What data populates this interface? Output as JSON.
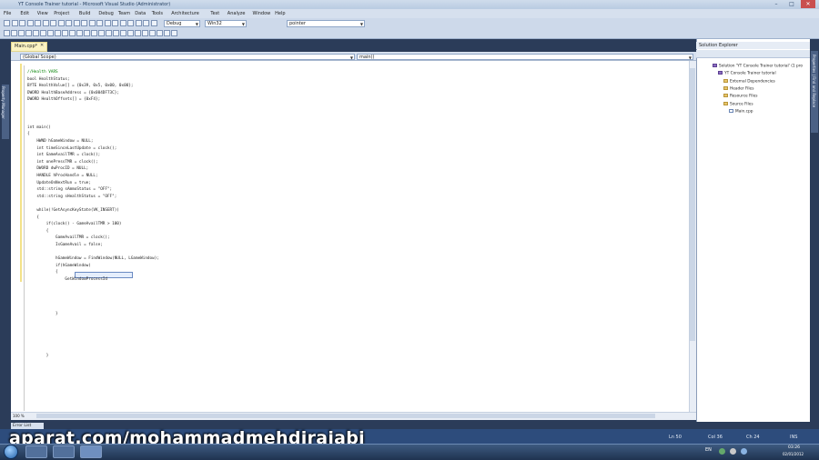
{
  "window": {
    "title": "YT Console Trainer tutorial - Microsoft Visual Studio (Administrator)",
    "minimize": "–",
    "maximize": "□",
    "close": "✕"
  },
  "menu": [
    "File",
    "Edit",
    "View",
    "Project",
    "Build",
    "Debug",
    "Team",
    "Data",
    "Tools",
    "Architecture",
    "Test",
    "Analyze",
    "Window",
    "Help"
  ],
  "toolbar": {
    "config": "Debug",
    "platform": "Win32",
    "find": "pointer"
  },
  "left_strip_label": "Property Manager",
  "document_tab": {
    "label": "Main.cpp*",
    "close": "✕"
  },
  "navbar": {
    "scope": "(Global Scope)",
    "member": "main()"
  },
  "code": [
    {
      "t": "cm",
      "s": "//Health VARS"
    },
    {
      "t": "n",
      "s": "bool HealthStatus;"
    },
    {
      "t": "n",
      "s": "BYTE HealthValue[] = {0x39, 0x5, 0x00, 0x00};"
    },
    {
      "t": "n",
      "s": "DWORD HealthBaseAddress = {0x004DF73C};"
    },
    {
      "t": "n",
      "s": "DWORD HealthOffsets[] = {0xF4};"
    },
    {
      "t": "b",
      "s": ""
    },
    {
      "t": "b",
      "s": ""
    },
    {
      "t": "b",
      "s": ""
    },
    {
      "t": "kw",
      "s": "int main()"
    },
    {
      "t": "n",
      "s": "{"
    },
    {
      "t": "n",
      "s": "    HWND hGameWindow = NULL;"
    },
    {
      "t": "n",
      "s": "    int timeSinceLastUpdate = clock();"
    },
    {
      "t": "n",
      "s": "    int GameAvailTMR = clock();"
    },
    {
      "t": "n",
      "s": "    int onePressTMR = clock();"
    },
    {
      "t": "n",
      "s": "    DWORD dwProcID = NULL;"
    },
    {
      "t": "n",
      "s": "    HANDLE hProcHandle = NULL;"
    },
    {
      "t": "n",
      "s": "    UpdateOnNextRun = true;"
    },
    {
      "t": "n",
      "s": "    std::string sAmmoStatus = \"OFF\";"
    },
    {
      "t": "n",
      "s": "    std::string sHealthStatus = \"OFF\";"
    },
    {
      "t": "b",
      "s": ""
    },
    {
      "t": "n",
      "s": "    while(!GetAsyncKeyState(VK_INSERT))"
    },
    {
      "t": "n",
      "s": "    {"
    },
    {
      "t": "n",
      "s": "        if(clock() - GameAvailTMR > 100)"
    },
    {
      "t": "n",
      "s": "        {"
    },
    {
      "t": "n",
      "s": "            GameAvailTMR = clock();"
    },
    {
      "t": "n",
      "s": "            IsGameAvail = false;"
    },
    {
      "t": "b",
      "s": ""
    },
    {
      "t": "n",
      "s": "            hGameWindow = FindWindow(NULL, LGameWindow);"
    },
    {
      "t": "n",
      "s": "            if(hGameWindow)"
    },
    {
      "t": "n",
      "s": "            {"
    },
    {
      "t": "n",
      "s": "                GetWindowProcessId"
    },
    {
      "t": "b",
      "s": ""
    },
    {
      "t": "b",
      "s": ""
    },
    {
      "t": "b",
      "s": ""
    },
    {
      "t": "b",
      "s": ""
    },
    {
      "t": "n",
      "s": "            }"
    },
    {
      "t": "b",
      "s": ""
    },
    {
      "t": "b",
      "s": ""
    },
    {
      "t": "b",
      "s": ""
    },
    {
      "t": "b",
      "s": ""
    },
    {
      "t": "b",
      "s": ""
    },
    {
      "t": "n",
      "s": "        }"
    }
  ],
  "editor": {
    "zoom": "100 %"
  },
  "solution_explorer": {
    "title": "Solution Explorer",
    "items": [
      {
        "label": "Solution 'YT Console Trainer tutorial' (1 pro",
        "indent": 0,
        "icon": "sln"
      },
      {
        "label": "YT Console Trainer tutorial",
        "indent": 1,
        "icon": "sln"
      },
      {
        "label": "External Dependencies",
        "indent": 2,
        "icon": "folder"
      },
      {
        "label": "Header Files",
        "indent": 2,
        "icon": "folder"
      },
      {
        "label": "Resource Files",
        "indent": 2,
        "icon": "folder"
      },
      {
        "label": "Source Files",
        "indent": 2,
        "icon": "folder"
      },
      {
        "label": "Main.cpp",
        "indent": 3,
        "icon": "doc"
      }
    ]
  },
  "right_strip_labels": "Properties | Find and Replace",
  "error_list_tab": "Error List",
  "status": {
    "ln": "Ln 50",
    "col": "Col 36",
    "ch": "Ch 24",
    "mode": "INS"
  },
  "watermark": "aparat.com/mohammadmehdirajabi",
  "taskbar": {
    "lang": "EN",
    "time": "03:26",
    "date": "02/01/2012"
  }
}
